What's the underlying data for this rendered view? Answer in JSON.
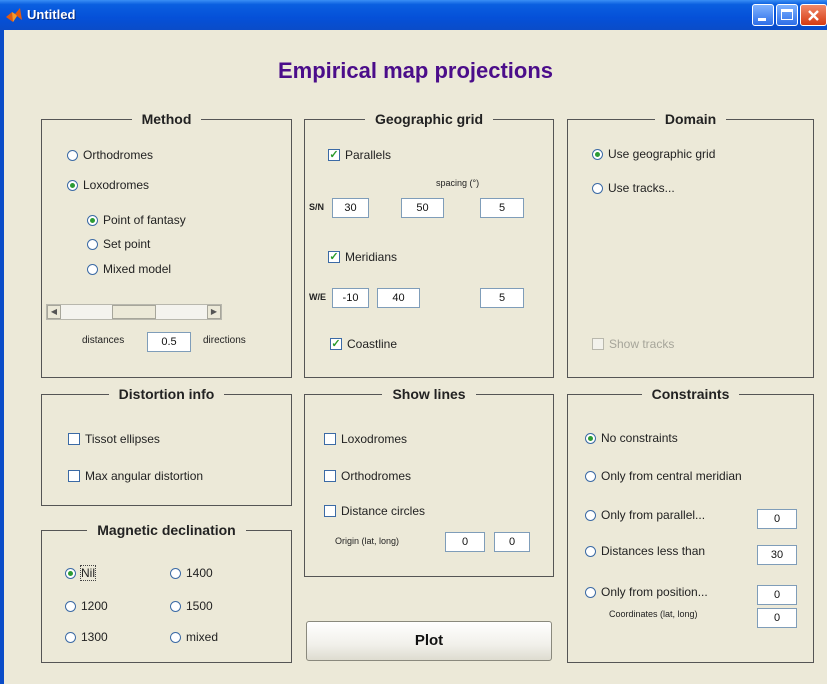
{
  "window": {
    "title": "Untitled"
  },
  "heading": "Empirical map projections",
  "method": {
    "title": "Method",
    "orthodromes": "Orthodromes",
    "loxodromes": "Loxodromes",
    "point_of_fantasy": "Point of fantasy",
    "set_point": "Set point",
    "mixed_model": "Mixed model",
    "slider_left": "distances",
    "slider_value": "0.5",
    "slider_right": "directions",
    "slider_level": 0.5
  },
  "geo_grid": {
    "title": "Geographic grid",
    "parallels": "Parallels",
    "spacing_label": "spacing (°)",
    "sn_label": "S/N",
    "sn_from": "30",
    "sn_to": "50",
    "sn_spacing": "5",
    "meridians": "Meridians",
    "we_label": "W/E",
    "we_from": "-10",
    "we_to": "40",
    "we_spacing": "5",
    "coastline": "Coastline"
  },
  "domain": {
    "title": "Domain",
    "use_grid": "Use geographic grid",
    "use_tracks": "Use tracks...",
    "show_tracks": "Show tracks"
  },
  "distortion": {
    "title": "Distortion info",
    "tissot": "Tissot ellipses",
    "max_angular": "Max angular distortion"
  },
  "show_lines": {
    "title": "Show lines",
    "loxodromes": "Loxodromes",
    "orthodromes": "Orthodromes",
    "distance_circles": "Distance circles",
    "origin_label": "Origin (lat, long)",
    "origin_lat": "0",
    "origin_long": "0"
  },
  "constraints": {
    "title": "Constraints",
    "none": "No constraints",
    "central_meridian": "Only from central meridian",
    "parallel": "Only from parallel...",
    "parallel_value": "0",
    "distances": "Distances less than",
    "distances_value": "30",
    "position": "Only from position...",
    "position_value": "0",
    "coords_label": "Coordinates (lat, long)",
    "coords_value": "0"
  },
  "magnetic": {
    "title": "Magnetic declination",
    "nil": "Nil",
    "y1400": "1400",
    "y1200": "1200",
    "y1500": "1500",
    "y1300": "1300",
    "mixed": "mixed"
  },
  "plot_label": "Plot"
}
